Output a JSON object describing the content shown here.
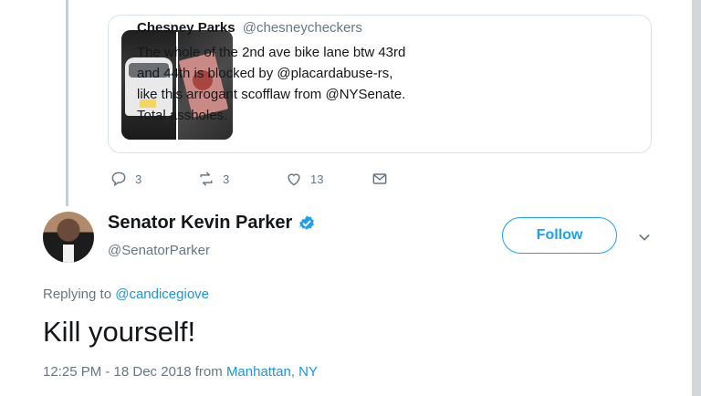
{
  "quoted_tweet": {
    "author_name": "Chesney Parks",
    "author_handle": "@chesneycheckers",
    "text": "The whole of the 2nd ave bike lane btw 43rd and 44th is blocked by @placardabuse-rs, like this arrogant scofflaw from @NYSenate. Total assholes.",
    "media": [
      "car-photo",
      "placard-photo"
    ]
  },
  "quoted_actions": {
    "reply_count": "3",
    "retweet_count": "3",
    "like_count": "13"
  },
  "tweet": {
    "author_name": "Senator Kevin Parker",
    "author_handle": "@SenatorParker",
    "verified": true,
    "follow_label": "Follow",
    "replying_prefix": "Replying to",
    "replying_to": "@candicegiove",
    "text": "Kill yourself!",
    "timestamp": "12:25 PM - 18 Dec 2018 from",
    "location": "Manhattan, NY"
  },
  "colors": {
    "accent": "#1da1f2",
    "link": "#1b95e0",
    "muted": "#657786",
    "text": "#14171a",
    "border": "#d9e2e8"
  },
  "icons": [
    "reply-icon",
    "retweet-icon",
    "like-icon",
    "message-icon",
    "verified-badge-icon",
    "chevron-down-icon"
  ]
}
